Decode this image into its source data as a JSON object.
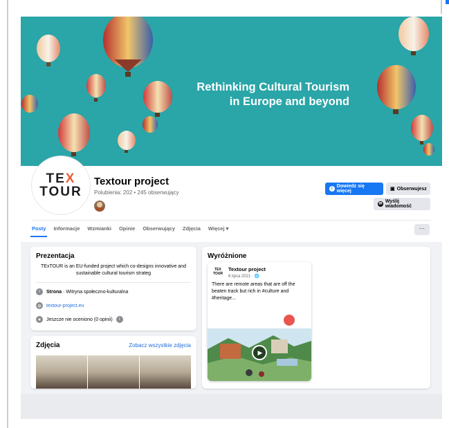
{
  "cover": {
    "headline_line1": "Rethinking Cultural Tourism",
    "headline_line2": "in Europe and beyond"
  },
  "profile": {
    "logo_line1": "TE",
    "logo_x": "X",
    "logo_line2": "TOUR",
    "name": "Textour project",
    "stats": "Polubienia: 202 • 245 obserwujący"
  },
  "actions": {
    "learn_more": "Dowiedz się więcej",
    "following": "Obserwujesz",
    "message": "Wyślij wiadomość",
    "more": "···"
  },
  "tabs": [
    "Posty",
    "Informacje",
    "Wzmianki",
    "Opinie",
    "Obserwujący",
    "Zdjęcia",
    "Więcej ▾"
  ],
  "about": {
    "title": "Prezentacja",
    "description": "TExTOUR is an EU-funded project which co-designs innovative and sustainable cultural tourism strateg",
    "category_label": "Strona",
    "category_value": " · Witryna społeczno-kulturalna",
    "website": "textour-project.eu",
    "rating": "Jeszcze nie oceniono (0 opinii)"
  },
  "photos": {
    "title": "Zdjęcia",
    "see_all": "Zobacz wszystkie zdjęcia"
  },
  "featured": {
    "title": "Wyróżnione",
    "post_logo_line1": "TEX",
    "post_logo_line2": "TOUR",
    "post_author": "Textour project",
    "post_date": "6 lipca 2021 · 🌐",
    "post_text": "There are remote areas that are off the beaten track but rich in #culture and #heritage..."
  },
  "colors": {
    "cover_bg": "#2aa5a8",
    "primary": "#1877f2",
    "accent_x": "#e8603c"
  }
}
